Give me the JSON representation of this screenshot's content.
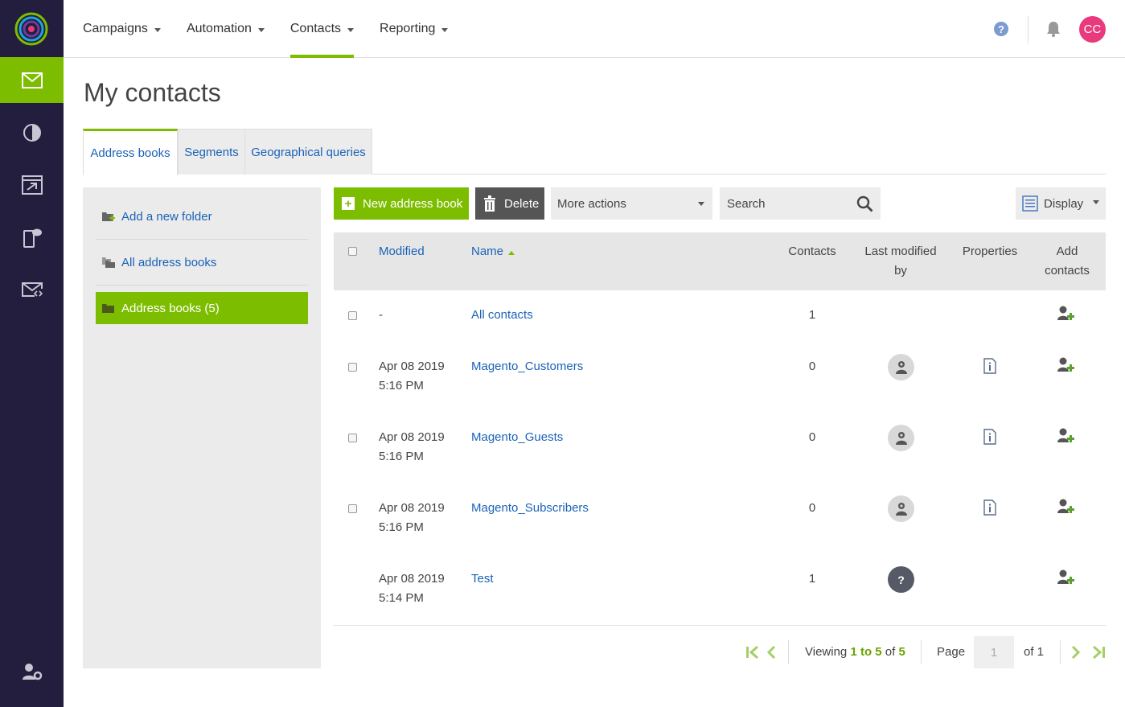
{
  "topnav": {
    "menu": [
      "Campaigns",
      "Automation",
      "Contacts",
      "Reporting"
    ],
    "active": "Contacts",
    "avatar_initials": "CC",
    "help_label": "?"
  },
  "page": {
    "title": "My contacts"
  },
  "tabs": [
    "Address books",
    "Segments",
    "Geographical queries"
  ],
  "sidebar": {
    "items": [
      {
        "label": "Add a new folder"
      },
      {
        "label": "All address books"
      },
      {
        "label": "Address books (5)"
      }
    ]
  },
  "toolbar": {
    "new_label": "New address book",
    "delete_label": "Delete",
    "more_label": "More actions",
    "search_placeholder": "Search",
    "display_label": "Display"
  },
  "table": {
    "headers": {
      "modified": "Modified",
      "name": "Name",
      "contacts": "Contacts",
      "last_modified_by": [
        "Last modified",
        "by"
      ],
      "properties": "Properties",
      "add_contacts": [
        "Add",
        "contacts"
      ]
    },
    "rows": [
      {
        "modified": [
          "-",
          ""
        ],
        "name": "All contacts",
        "contacts": "1",
        "modified_by": "",
        "properties": false,
        "checkbox": true
      },
      {
        "modified": [
          "Apr 08 2019",
          "5:16 PM"
        ],
        "name": "Magento_Customers",
        "contacts": "0",
        "modified_by": "system",
        "properties": true,
        "checkbox": true
      },
      {
        "modified": [
          "Apr 08 2019",
          "5:16 PM"
        ],
        "name": "Magento_Guests",
        "contacts": "0",
        "modified_by": "system",
        "properties": true,
        "checkbox": true
      },
      {
        "modified": [
          "Apr 08 2019",
          "5:16 PM"
        ],
        "name": "Magento_Subscribers",
        "contacts": "0",
        "modified_by": "system",
        "properties": true,
        "checkbox": true
      },
      {
        "modified": [
          "Apr 08 2019",
          "5:14 PM"
        ],
        "name": "Test",
        "contacts": "1",
        "modified_by": "unknown",
        "properties": false,
        "checkbox": false
      }
    ],
    "unknown_user_label": "?"
  },
  "pager": {
    "viewing_prefix": "Viewing",
    "range": "1 to 5",
    "of_word": "of",
    "total": "5",
    "page_label": "Page",
    "page_value": "1",
    "of_pages": "of 1"
  },
  "colors": {
    "accent": "#7dbd00",
    "rail": "#231e3d",
    "link": "#1a62b8",
    "avatar": "#e93a7d"
  }
}
